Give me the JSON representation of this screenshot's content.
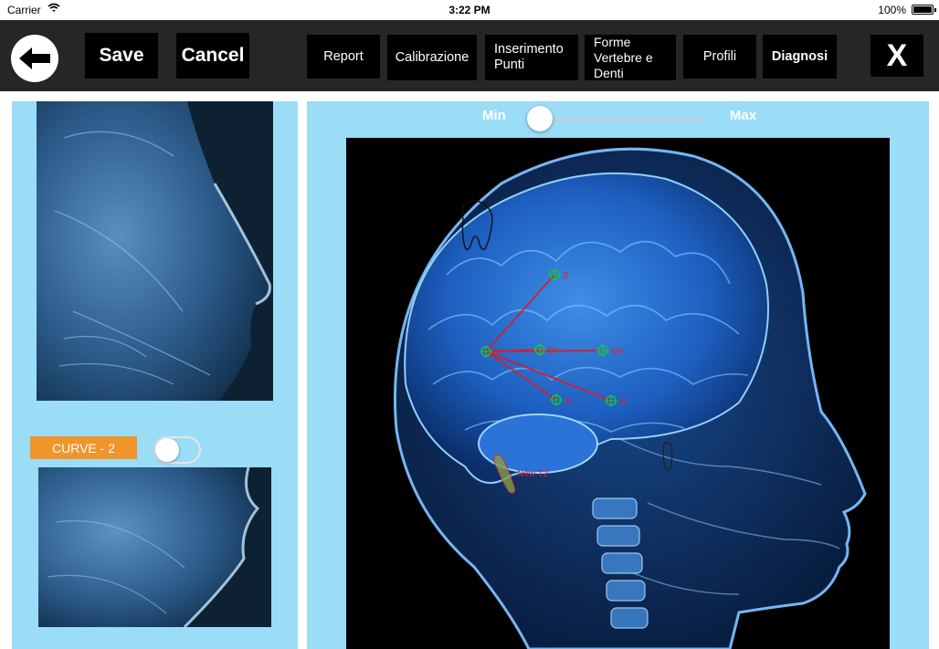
{
  "status_bar": {
    "carrier": "Carrier",
    "time": "3:22 PM",
    "battery": "100%"
  },
  "toolbar": {
    "save_label": "Save",
    "cancel_label": "Cancel",
    "report_label": "Report",
    "calibration_label": "Calibrazione",
    "insert_points_label": "Inserimento Punti",
    "shapes_label": "Forme Vertebre e Denti",
    "profiles_label": "Profili",
    "diagnosis_label": "Diagnosi",
    "close_label": "X"
  },
  "left_panel": {
    "curve_label": "CURVE - 2",
    "curve_toggle_on": false
  },
  "slider": {
    "min_label": "Min",
    "max_label": "Max",
    "value": 0
  },
  "landmarks": [
    {
      "label": "S"
    },
    {
      "label": "N"
    },
    {
      "label": "Or"
    },
    {
      "label": "Me"
    },
    {
      "label": "A"
    },
    {
      "label": "B"
    }
  ],
  "shape_label": "New T2",
  "colors": {
    "toolbar": "#262626",
    "panel": "#9bdcf7",
    "curve_label_bg": "#f0942c",
    "landmark_ring": "#22c03a",
    "landmark_line": "#d0202e"
  }
}
